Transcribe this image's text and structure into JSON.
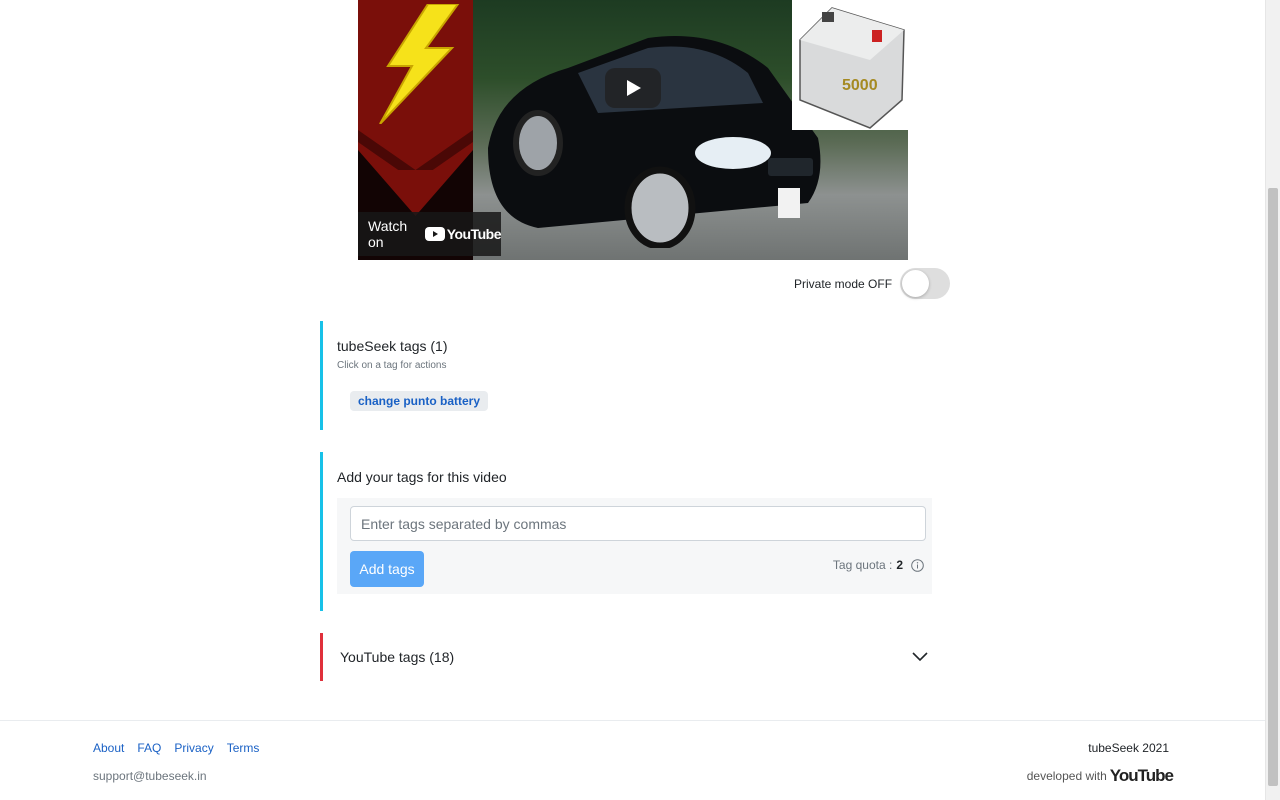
{
  "video": {
    "watch_on_label": "Watch on",
    "youtube_word": "YouTube",
    "battery_label": "5000"
  },
  "private_mode": {
    "label": "Private mode OFF",
    "enabled": false
  },
  "tubeseek_tags": {
    "title": "tubeSeek tags (1)",
    "subtitle": "Click on a tag for actions",
    "tags": [
      "change punto battery"
    ]
  },
  "add_tags": {
    "title": "Add your tags for this video",
    "placeholder": "Enter tags separated by commas",
    "value": "",
    "button_label": "Add tags",
    "quota_label": "Tag quota :",
    "quota_value": "2"
  },
  "youtube_tags": {
    "title": "YouTube tags (18)"
  },
  "footer": {
    "links": [
      "About",
      "FAQ",
      "Privacy",
      "Terms"
    ],
    "support_email": "support@tubeseek.in",
    "copyright": "tubeSeek 2021",
    "developed_with": "developed with",
    "youtube_word": "YouTube"
  },
  "colors": {
    "accent_cyan": "#17c1e8",
    "accent_red": "#e0303b",
    "link_blue": "#1a61c5",
    "button_blue": "#5aa7f7"
  }
}
